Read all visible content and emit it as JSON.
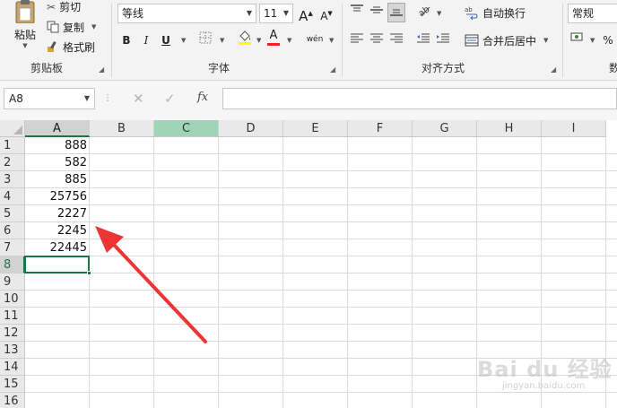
{
  "clipboard": {
    "paste_label": "粘贴",
    "cut_label": "剪切",
    "copy_label": "复制",
    "format_painter_label": "格式刷",
    "group_label": "剪贴板"
  },
  "font": {
    "font_name": "等线",
    "font_size": "11",
    "grow_label": "A",
    "shrink_label": "A",
    "bold_label": "B",
    "italic_label": "I",
    "underline_label": "U",
    "font_color_label": "A",
    "phonetic_label": "wén",
    "group_label": "字体"
  },
  "alignment": {
    "wrap_text_label": "自动换行",
    "merge_center_label": "合并后居中",
    "group_label": "对齐方式"
  },
  "number": {
    "format": "常规",
    "percent_label": "%",
    "group_label": "数"
  },
  "formula_bar": {
    "name_box": "A8",
    "fx_label": "fx",
    "formula": ""
  },
  "sheet": {
    "columns": [
      "A",
      "B",
      "C",
      "D",
      "E",
      "F",
      "G",
      "H",
      "I"
    ],
    "rows": [
      "1",
      "2",
      "3",
      "4",
      "5",
      "6",
      "7",
      "8",
      "9",
      "10",
      "11",
      "12",
      "13",
      "14",
      "15",
      "16"
    ],
    "values": [
      "888",
      "582",
      "885",
      "25756",
      "2227",
      "2245",
      "22445"
    ],
    "active_cell": "A8"
  },
  "colors": {
    "accent": "#217346",
    "annotation_arrow": "#ee3535"
  },
  "watermark": {
    "text": "Bai du 经验",
    "sub": "jingyan.baidu.com"
  }
}
